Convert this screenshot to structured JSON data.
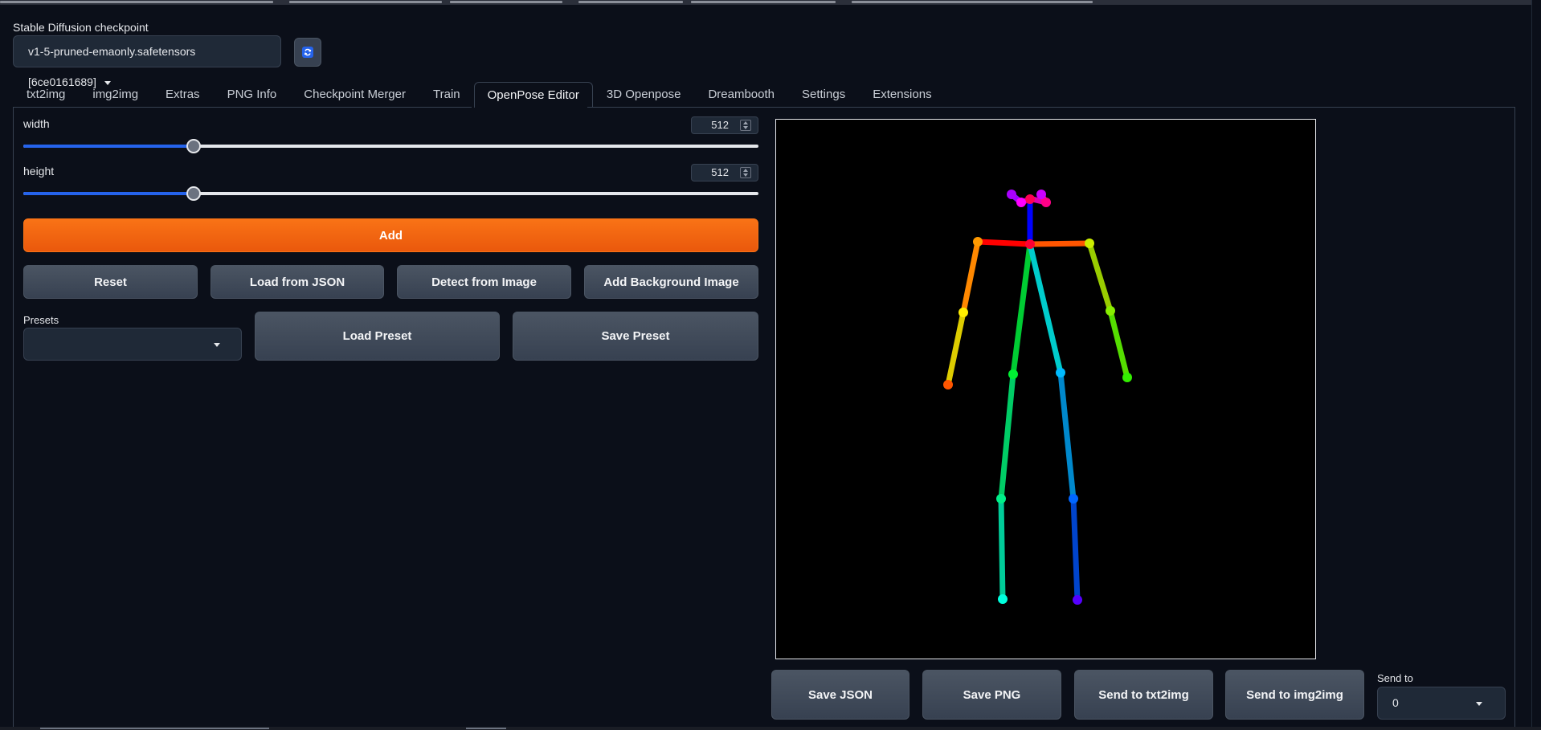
{
  "checkpoint": {
    "label": "Stable Diffusion checkpoint",
    "value": "v1-5-pruned-emaonly.safetensors [6ce0161689]",
    "refresh_icon": "refresh-icon"
  },
  "tabs": [
    {
      "label": "txt2img",
      "active": false
    },
    {
      "label": "img2img",
      "active": false
    },
    {
      "label": "Extras",
      "active": false
    },
    {
      "label": "PNG Info",
      "active": false
    },
    {
      "label": "Checkpoint Merger",
      "active": false
    },
    {
      "label": "Train",
      "active": false
    },
    {
      "label": "OpenPose Editor",
      "active": true
    },
    {
      "label": "3D Openpose",
      "active": false
    },
    {
      "label": "Dreambooth",
      "active": false
    },
    {
      "label": "Settings",
      "active": false
    },
    {
      "label": "Extensions",
      "active": false
    }
  ],
  "width": {
    "label": "width",
    "value": "512",
    "fraction": 0.232
  },
  "height": {
    "label": "height",
    "value": "512",
    "fraction": 0.232
  },
  "buttons": {
    "add": "Add",
    "reset": "Reset",
    "load_json": "Load from JSON",
    "detect": "Detect from Image",
    "add_bg": "Add Background Image",
    "load_preset": "Load Preset",
    "save_preset": "Save Preset",
    "save_json": "Save JSON",
    "save_png": "Save PNG",
    "send_txt2img": "Send to txt2img",
    "send_img2img": "Send to img2img"
  },
  "presets": {
    "label": "Presets",
    "value": ""
  },
  "send_to": {
    "label": "Send to",
    "value": "0"
  },
  "colors": {
    "accent": "#f97316",
    "slider_fill": "#2563eb",
    "background": "#0b0f19"
  }
}
